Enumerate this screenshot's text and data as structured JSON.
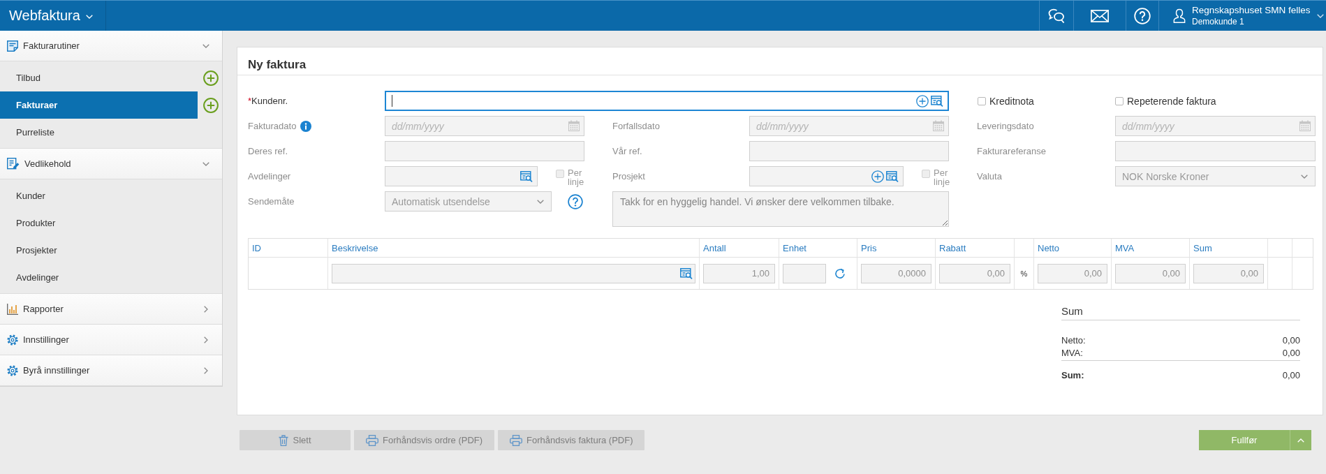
{
  "header": {
    "title": "Webfaktura",
    "user": {
      "name": "Regnskapshuset SMN felles",
      "client": "Demokunde 1"
    }
  },
  "sidebar": {
    "sections": [
      {
        "title": "Fakturarutiner",
        "expanded": true,
        "items": [
          {
            "label": "Tilbud",
            "selected": false,
            "add_button": true
          },
          {
            "label": "Fakturaer",
            "selected": true,
            "add_button": true
          },
          {
            "label": "Purreliste",
            "selected": false,
            "add_button": false
          }
        ]
      },
      {
        "title": "Vedlikehold",
        "expanded": true,
        "items": [
          {
            "label": "Kunder",
            "selected": false,
            "add_button": false
          },
          {
            "label": "Produkter",
            "selected": false,
            "add_button": false
          },
          {
            "label": "Prosjekter",
            "selected": false,
            "add_button": false
          },
          {
            "label": "Avdelinger",
            "selected": false,
            "add_button": false
          }
        ]
      },
      {
        "title": "Rapporter",
        "expanded": false
      },
      {
        "title": "Innstillinger",
        "expanded": false
      },
      {
        "title": "Byrå innstillinger",
        "expanded": false
      }
    ]
  },
  "form": {
    "title": "Ny faktura",
    "rows": [
      [
        {
          "kind": "customer",
          "label": "Kundenr.",
          "required_mark": "*",
          "disabled": false,
          "focused": true,
          "add_button": true
        },
        "",
        {
          "kind": "options",
          "items": [
            {
              "label": "Kreditnota",
              "checked": false,
              "disabled": false
            },
            {
              "label": "Repeterende faktura",
              "checked": false,
              "disabled": false
            }
          ]
        }
      ],
      [
        {
          "kind": "date",
          "label": "Fakturadato",
          "info": true,
          "placeholder": "dd/mm/yyyy",
          "disabled": true
        },
        {
          "kind": "date",
          "label": "Forfallsdato",
          "placeholder": "dd/mm/yyyy",
          "disabled": true
        },
        {
          "kind": "date",
          "label": "Leveringsdato",
          "placeholder": "dd/mm/yyyy",
          "disabled": true
        }
      ],
      [
        {
          "kind": "text",
          "label": "Deres ref.",
          "disabled": true
        },
        {
          "kind": "text",
          "label": "Vår ref.",
          "disabled": true
        },
        {
          "kind": "text",
          "label": "Fakturareferanse",
          "disabled": true
        }
      ],
      [
        {
          "kind": "lookup",
          "label": "Avdelinger",
          "disabled": true,
          "add_button": false,
          "per_line": {
            "label": "Per linje",
            "checked": false,
            "disabled": true
          }
        },
        {
          "kind": "lookup",
          "label": "Prosjekt",
          "disabled": true,
          "add_button": true,
          "per_line": {
            "label": "Per linje",
            "checked": false,
            "disabled": true
          }
        },
        {
          "kind": "select",
          "label": "Valuta",
          "value": "NOK Norske Kroner",
          "disabled": true
        }
      ],
      [
        {
          "kind": "select",
          "label": "Sendemåte",
          "value": "Automatisk utsendelse",
          "help": true,
          "disabled": true
        },
        {
          "kind": "textarea",
          "value": "Takk for en hyggelig handel. Vi ønsker dere velkommen tilbake.",
          "disabled": true
        }
      ]
    ]
  },
  "lines": {
    "columns": [
      {
        "kind": "heading",
        "label": "ID"
      },
      {
        "kind": "heading",
        "label": "Beskrivelse"
      },
      {
        "kind": "heading",
        "label": "Antall"
      },
      {
        "kind": "heading",
        "label": "Enhet"
      },
      {
        "kind": "heading",
        "label": "Pris"
      },
      {
        "kind": "heading",
        "label": "Rabatt"
      },
      {
        "kind": "blank"
      },
      {
        "kind": "heading",
        "label": "Netto"
      },
      {
        "kind": "heading",
        "label": "MVA"
      },
      {
        "kind": "heading",
        "label": "Sum"
      },
      {
        "kind": "blank"
      },
      {
        "kind": "blank"
      }
    ],
    "rows": [
      {
        "cells": [
          {
            "kind": "blank"
          },
          {
            "kind": "lookup",
            "disabled": true
          },
          {
            "kind": "number",
            "value": "1,00",
            "disabled": true
          },
          {
            "kind": "unit",
            "disabled": true
          },
          {
            "kind": "number",
            "value": "0,0000",
            "disabled": true
          },
          {
            "kind": "number",
            "value": "0,00",
            "disabled": true
          },
          {
            "kind": "text",
            "value": "%"
          },
          {
            "kind": "number",
            "value": "0,00",
            "disabled": true
          },
          {
            "kind": "number",
            "value": "0,00",
            "disabled": true
          },
          {
            "kind": "number",
            "value": "0,00",
            "disabled": true
          },
          {
            "kind": "blank"
          },
          {
            "kind": "blank"
          }
        ]
      }
    ]
  },
  "totals": {
    "title": "Sum",
    "lines": [
      {
        "label": "Netto:",
        "value": "0,00",
        "total": false
      },
      {
        "label": "MVA:",
        "value": "0,00",
        "total": false
      },
      {
        "label": "Sum:",
        "value": "0,00",
        "total": true
      }
    ]
  },
  "footer": {
    "actions": [
      {
        "kind": "delete",
        "label": "Slett",
        "disabled": true
      },
      {
        "kind": "print",
        "label": "Forhåndsvis ordre (PDF)",
        "disabled": true
      },
      {
        "kind": "print",
        "label": "Forhåndsvis faktura (PDF)",
        "disabled": true
      }
    ],
    "submit": {
      "label": "Fullfør",
      "disabled": false
    }
  }
}
